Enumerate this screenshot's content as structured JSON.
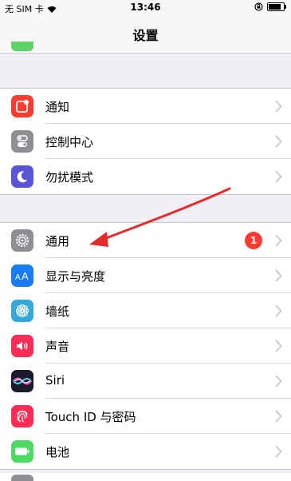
{
  "status": {
    "carrier": "无 SIM 卡",
    "time": "13:46",
    "battery_level": 0.85
  },
  "nav": {
    "title": "设置"
  },
  "groups": [
    {
      "items": [
        {
          "label": "通知",
          "icon": "notifications-icon",
          "color": "#ff3b30"
        },
        {
          "label": "控制中心",
          "icon": "control-center-icon",
          "color": "#8e8e93"
        },
        {
          "label": "勿扰模式",
          "icon": "moon-icon",
          "color": "#5856d6"
        }
      ]
    },
    {
      "items": [
        {
          "label": "通用",
          "icon": "gear-icon",
          "color": "#8e8e93",
          "badge": "1"
        },
        {
          "label": "显示与亮度",
          "icon": "display-brightness-icon",
          "color": "#1a7cf5"
        },
        {
          "label": "墙纸",
          "icon": "wallpaper-flower-icon",
          "color": "#35a9d9"
        },
        {
          "label": "声音",
          "icon": "speaker-icon",
          "color": "#ff2d55"
        },
        {
          "label": "Siri",
          "icon": "siri-icon",
          "color": "#1b1b2e"
        },
        {
          "label": "Touch ID 与密码",
          "icon": "fingerprint-icon",
          "color": "#ff2d55"
        },
        {
          "label": "电池",
          "icon": "battery-icon",
          "color": "#4cd964"
        }
      ]
    }
  ],
  "colors": {
    "badge": "#ff3b30",
    "arrow": "#e52b2b"
  }
}
